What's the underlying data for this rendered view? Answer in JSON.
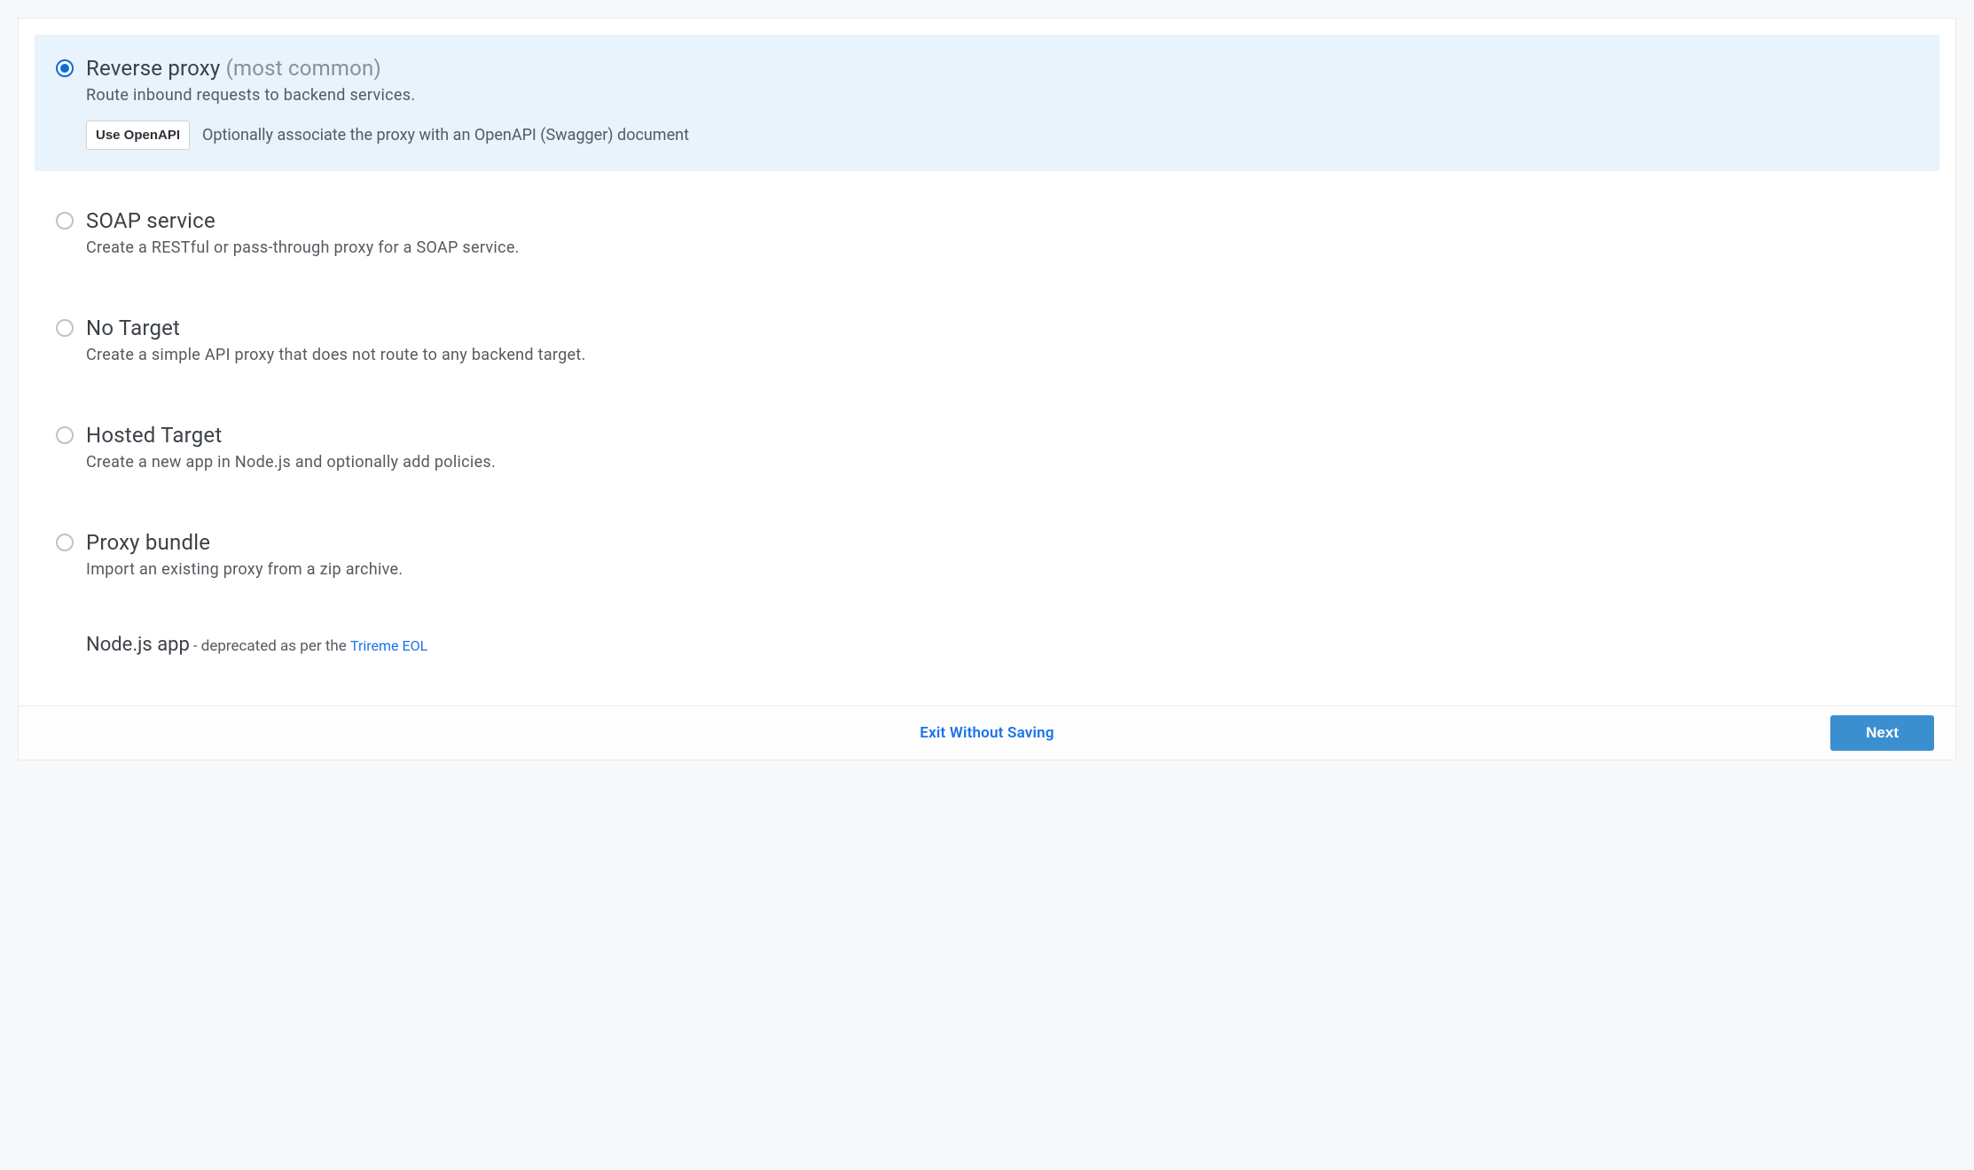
{
  "options": [
    {
      "key": "reverse-proxy",
      "title": "Reverse proxy",
      "qualifier": "(most common)",
      "description": "Route inbound requests to backend services.",
      "selected": true,
      "openapi": {
        "button": "Use OpenAPI",
        "text": "Optionally associate the proxy with an OpenAPI (Swagger) document"
      }
    },
    {
      "key": "soap-service",
      "title": "SOAP service",
      "description": "Create a RESTful or pass-through proxy for a SOAP service.",
      "selected": false
    },
    {
      "key": "no-target",
      "title": "No Target",
      "description": "Create a simple API proxy that does not route to any backend target.",
      "selected": false
    },
    {
      "key": "hosted-target",
      "title": "Hosted Target",
      "description": "Create a new app in Node.js and optionally add policies.",
      "selected": false
    },
    {
      "key": "proxy-bundle",
      "title": "Proxy bundle",
      "description": "Import an existing proxy from a zip archive.",
      "selected": false
    }
  ],
  "deprecated": {
    "title": "Node.js app",
    "text": " - deprecated as per the ",
    "link": "Trireme EOL"
  },
  "footer": {
    "exit": "Exit Without Saving",
    "next": "Next"
  }
}
